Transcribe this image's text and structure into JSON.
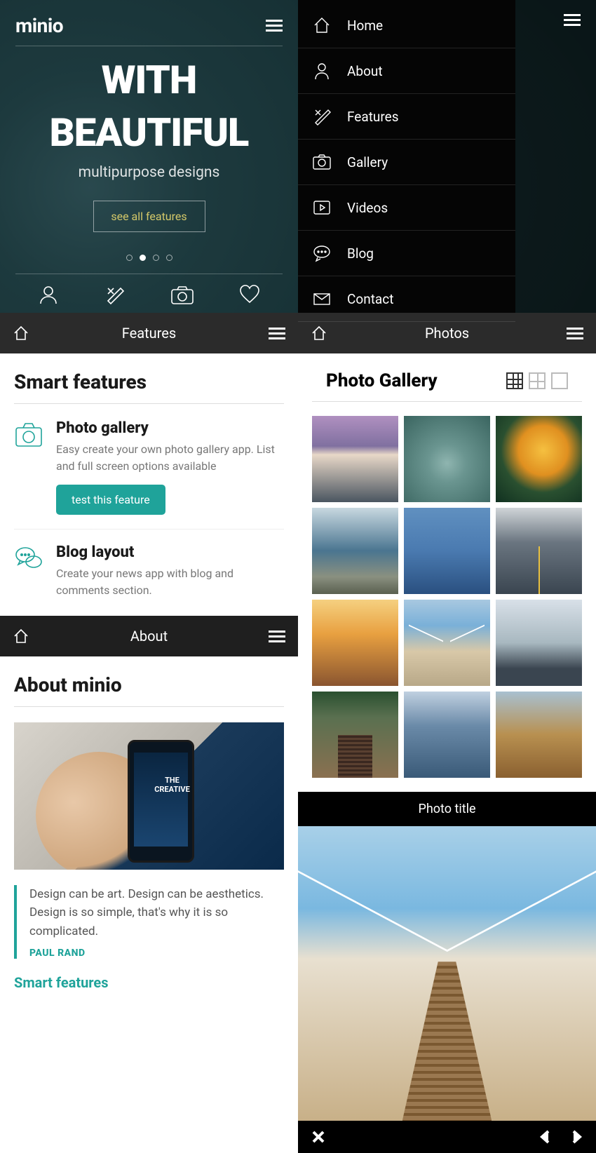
{
  "hero": {
    "logo": "minio",
    "headline1": "WITH",
    "headline2": "BEAUTIFUL",
    "sub": "multipurpose designs",
    "cta": "see all features"
  },
  "nav": {
    "items": [
      {
        "label": "Home"
      },
      {
        "label": "About"
      },
      {
        "label": "Features"
      },
      {
        "label": "Gallery"
      },
      {
        "label": "Videos"
      },
      {
        "label": "Blog"
      },
      {
        "label": "Contact"
      }
    ]
  },
  "bars": {
    "features": "Features",
    "photos": "Photos",
    "about": "About"
  },
  "features": {
    "heading": "Smart features",
    "items": [
      {
        "title": "Photo gallery",
        "desc": "Easy create your own photo gallery app. List and full screen options available",
        "btn": "test this feature"
      },
      {
        "title": "Blog layout",
        "desc": "Create your news app with blog and comments section."
      }
    ]
  },
  "about": {
    "heading": "About minio",
    "quote": "Design can be art. Design can be aesthetics. Design is so simple, that's why it is so complicated.",
    "author": "PAUL RAND",
    "link": "Smart features"
  },
  "gallery": {
    "heading": "Photo Gallery"
  },
  "lightbox": {
    "title": "Photo title"
  }
}
